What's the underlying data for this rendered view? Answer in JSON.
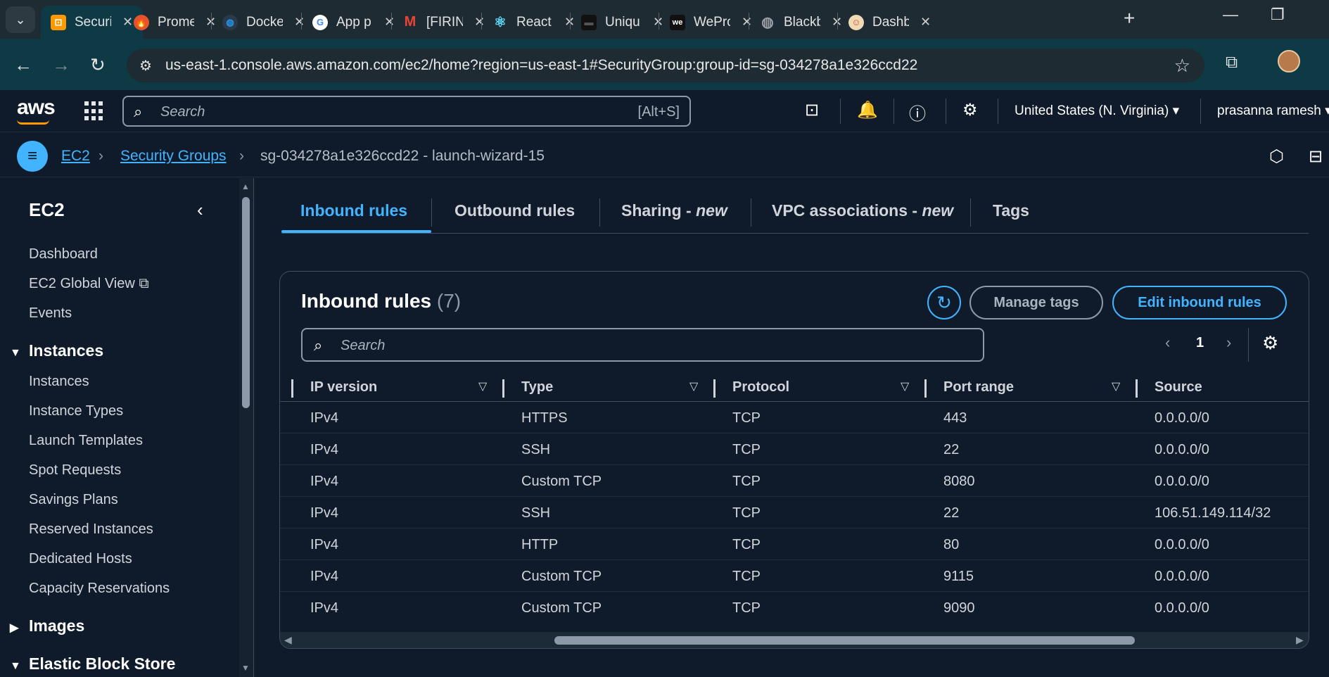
{
  "browser": {
    "tabs": [
      {
        "label": "Securi",
        "icon": "aws-icon",
        "color": "#ff9900"
      },
      {
        "label": "Prome",
        "icon": "prometheus-icon",
        "color": "#e6522c"
      },
      {
        "label": "Docke",
        "icon": "docker-icon",
        "color": "#2496ed"
      },
      {
        "label": "App p",
        "icon": "google-icon",
        "color": "#4285f4"
      },
      {
        "label": "[FIRIN",
        "icon": "gmail-icon",
        "color": "#ea4335"
      },
      {
        "label": "React",
        "icon": "react-icon",
        "color": "#61dafb"
      },
      {
        "label": "Uniqu",
        "icon": "site-icon",
        "color": "#222222"
      },
      {
        "label": "WePro",
        "icon": "we-icon",
        "color": "#222222"
      },
      {
        "label": "Blackb",
        "icon": "globe-icon",
        "color": "#9aa0a6"
      },
      {
        "label": "Dashb",
        "icon": "jenkins-icon",
        "color": "#d24939"
      }
    ],
    "url": "us-east-1.console.aws.amazon.com/ec2/home?region=us-east-1#SecurityGroup:group-id=sg-034278a1e326ccd22"
  },
  "aws_header": {
    "logo": "aws",
    "search_placeholder": "Search",
    "search_shortcut": "[Alt+S]",
    "region": "United States (N. Virginia) ▾",
    "user": "prasanna ramesh ▾"
  },
  "breadcrumb": {
    "root": "EC2",
    "section": "Security Groups",
    "current": "sg-034278a1e326ccd22 - launch-wizard-15"
  },
  "sidebar": {
    "title": "EC2",
    "items": [
      "Dashboard",
      "EC2 Global View",
      "Events"
    ],
    "instances_header": "Instances",
    "instances_items": [
      "Instances",
      "Instance Types",
      "Launch Templates",
      "Spot Requests",
      "Savings Plans",
      "Reserved Instances",
      "Dedicated Hosts",
      "Capacity Reservations"
    ],
    "images_header": "Images",
    "ebs_header": "Elastic Block Store"
  },
  "content_tabs": {
    "inbound": "Inbound rules",
    "outbound": "Outbound rules",
    "sharing": "Sharing - ",
    "vpc": "VPC associations - ",
    "new_tag": "new",
    "tags": "Tags"
  },
  "panel": {
    "title": "Inbound rules",
    "count": "(7)",
    "manage_tags": "Manage tags",
    "edit_rules": "Edit inbound rules",
    "search_placeholder": "Search",
    "page": "1"
  },
  "table": {
    "columns": [
      "IP version",
      "Type",
      "Protocol",
      "Port range",
      "Source"
    ],
    "rows": [
      [
        "IPv4",
        "HTTPS",
        "TCP",
        "443",
        "0.0.0.0/0"
      ],
      [
        "IPv4",
        "SSH",
        "TCP",
        "22",
        "0.0.0.0/0"
      ],
      [
        "IPv4",
        "Custom TCP",
        "TCP",
        "8080",
        "0.0.0.0/0"
      ],
      [
        "IPv4",
        "SSH",
        "TCP",
        "22",
        "106.51.149.114/32"
      ],
      [
        "IPv4",
        "HTTP",
        "TCP",
        "80",
        "0.0.0.0/0"
      ],
      [
        "IPv4",
        "Custom TCP",
        "TCP",
        "9115",
        "0.0.0.0/0"
      ],
      [
        "IPv4",
        "Custom TCP",
        "TCP",
        "9090",
        "0.0.0.0/0"
      ]
    ]
  },
  "colors": {
    "accent": "#42b4ff",
    "background": "#0f1b2a",
    "aws_orange": "#ff9900"
  }
}
